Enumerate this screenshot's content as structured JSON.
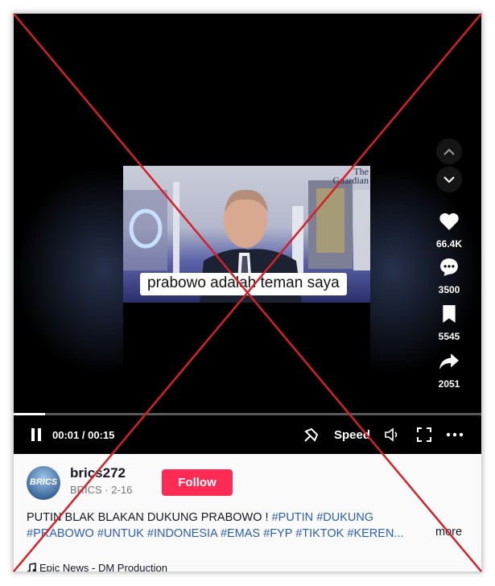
{
  "player": {
    "subtitle": "prabowo adalah teman saya",
    "watermark_line1": "The",
    "watermark_line2": "Guardian",
    "progress_fraction": 0.0667,
    "time_display": "00:01 / 00:15",
    "speed_label": "Speed"
  },
  "actions": {
    "likes": "66.4K",
    "comments": "3500",
    "saves": "5545",
    "shares": "2051"
  },
  "post": {
    "avatar_text": "BRICS",
    "username": "brics272",
    "subline": "BRICS · 2-16",
    "follow_label": "Follow",
    "caption_text": "PUTIN BLAK BLAKAN DUKUNG PRABOWO ! ",
    "hashtags_line1": [
      "#PUTIN",
      "#DUKUNG"
    ],
    "hashtags_line2": [
      "#PRABOWO",
      "#UNTUK",
      "#INDONESIA",
      "#EMAS",
      "#FYP",
      "#TIKTOK",
      "#KEREN..."
    ],
    "more_label": "more",
    "music": "Epic News - DM Production"
  },
  "colors": {
    "follow_button": "#fe2c55",
    "hashtag": "#2b5db9",
    "x_mark": "#d62027"
  },
  "icons": [
    "chevron-up-icon",
    "chevron-down-icon",
    "heart-icon",
    "comment-icon",
    "bookmark-icon",
    "share-icon",
    "pause-icon",
    "pip-icon",
    "volume-icon",
    "fullscreen-icon",
    "more-icon",
    "music-note-icon"
  ]
}
